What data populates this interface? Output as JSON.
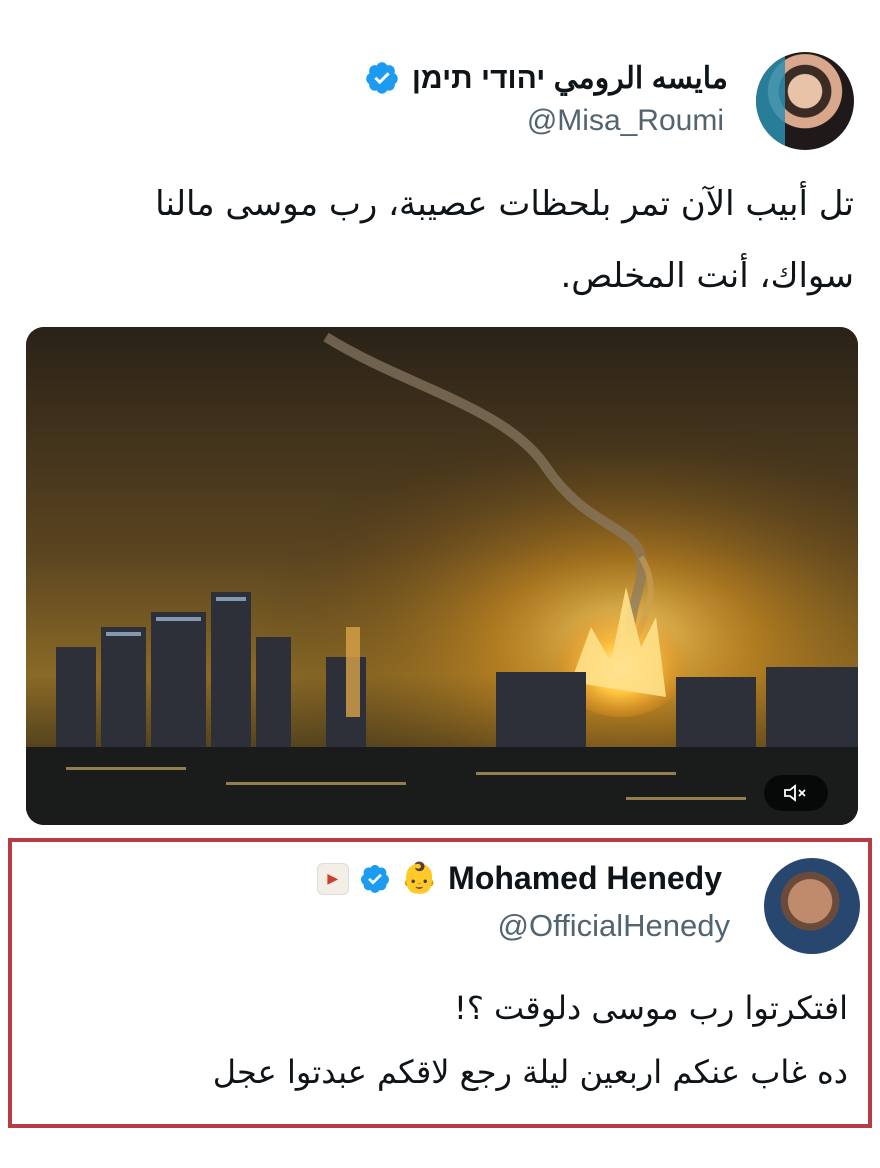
{
  "tweet1": {
    "display_name": "مايسه الرومي יהודי תימן",
    "handle": "@Misa_Roumi",
    "verified": true,
    "text_line1": "تل أبيب الآن تمر بلحظات عصيبة، رب موسى مالنا",
    "text_line2": "سواك، أنت المخلص.",
    "media": {
      "type": "video",
      "mute_icon": "speaker-muted-icon"
    }
  },
  "tweet2": {
    "display_name": "Mohamed Henedy",
    "emoji": "👶",
    "handle": "@OfficialHenedy",
    "verified": true,
    "text_line1": "افتكرتوا رب موسى دلوقت ؟!",
    "text_line2": "ده غاب عنكم اربعين ليلة رجع لاقكم عبدتوا عجل"
  },
  "colors": {
    "verified_blue": "#1d9bf0",
    "handle_gray": "#536471",
    "highlight_border": "#b83a45"
  }
}
